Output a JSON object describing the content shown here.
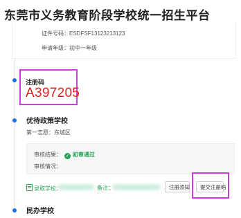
{
  "header": {
    "title": "东莞市义务教育阶段学校统一招生平台"
  },
  "applicant": {
    "cert_label": "证件号码：",
    "cert_value": "ESDFSF13123213123",
    "grade_label": "申请年级：",
    "grade_value": "初中一年级"
  },
  "registration": {
    "label": "注册码",
    "code": "A397205"
  },
  "policy_section": {
    "title": "优待政策学校",
    "first_choice_label": "第一志愿：",
    "first_choice_value": "东城区",
    "audit_result_label": "审核结果：",
    "audit_result_value": "初审通过",
    "audit_status_label": "审核情况：",
    "admit_label": "录取学校：",
    "note_label": "备注：",
    "buttons": {
      "notice": "注册须知",
      "submit": "提交注册码"
    }
  },
  "private_section": {
    "title": "民办学校"
  },
  "colors": {
    "accent": "#1a73e8",
    "code_red": "#e0211b",
    "pass_green": "#23a455",
    "highlight": "#cc3ddb"
  }
}
